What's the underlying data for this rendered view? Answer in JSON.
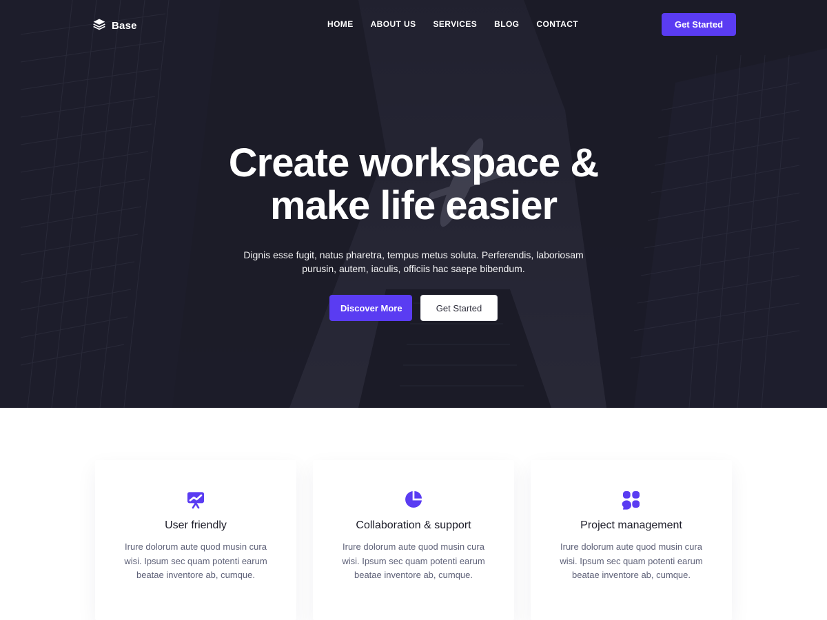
{
  "brand": {
    "name": "Base",
    "accent": "#5A3CF2",
    "hero_overlay": "#191926",
    "icon": "layers-icon"
  },
  "nav": {
    "links": [
      "HOME",
      "ABOUT US",
      "SERVICES",
      "BLOG",
      "CONTACT"
    ],
    "cta_label": "Get Started"
  },
  "hero": {
    "title_line1": "Create workspace &",
    "title_line2": "make life easier",
    "subtitle_line1": "Dignis esse fugit, natus pharetra, tempus metus soluta. Perferendis, laboriosam",
    "subtitle_line2": "purusin, autem, iaculis, officiis hac saepe bibendum.",
    "primary_label": "Discover More",
    "secondary_label": "Get Started"
  },
  "features": [
    {
      "icon": "presentation-chart-icon",
      "title": "User friendly",
      "text": "Irure dolorum aute quod musin cura wisi. Ipsum sec quam potenti earum beatae inventore ab, cumque."
    },
    {
      "icon": "pie-chart-icon",
      "title": "Collaboration & support",
      "text": "Irure dolorum aute quod musin cura wisi. Ipsum sec quam potenti earum beatae inventore ab, cumque."
    },
    {
      "icon": "apps-grid-icon",
      "title": "Project management",
      "text": "Irure dolorum aute quod musin cura wisi. Ipsum sec quam potenti earum beatae inventore ab, cumque."
    }
  ]
}
